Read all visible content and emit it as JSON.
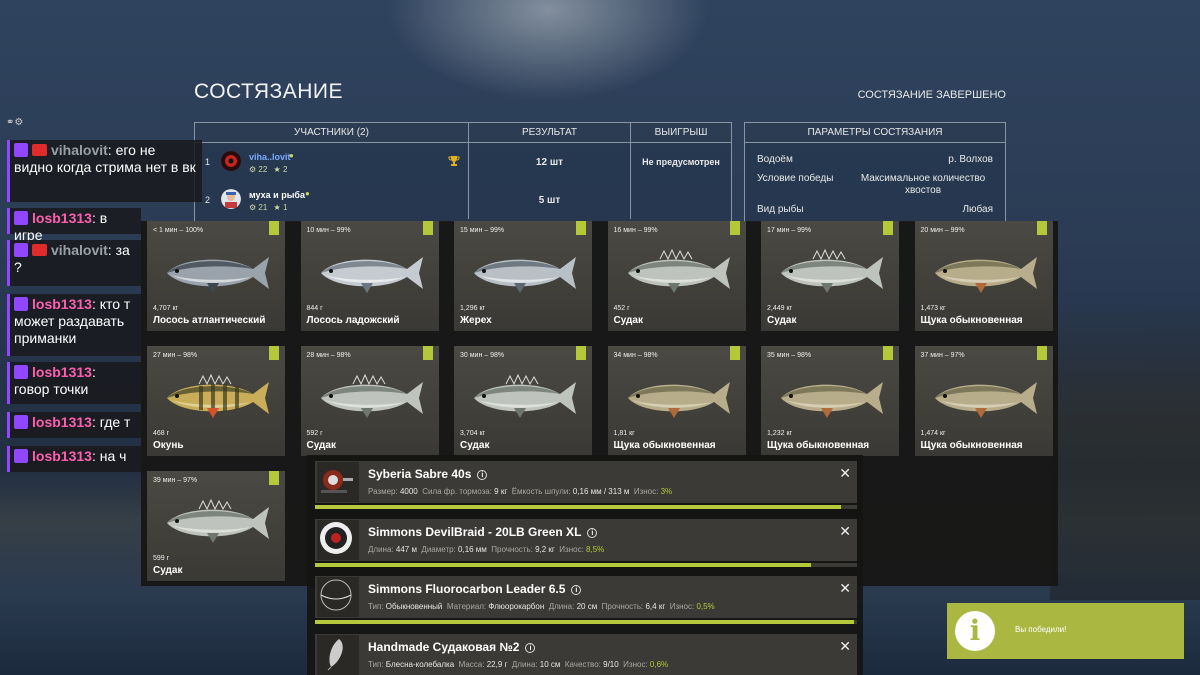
{
  "header": {
    "title": "СОСТЯЗАНИЕ",
    "status": "СОСТЯЗАНИЕ ЗАВЕРШЕНО"
  },
  "participants": {
    "headers": [
      "УЧАСТНИКИ (2)",
      "РЕЗУЛЬТАТ",
      "ВЫИГРЫШ"
    ],
    "rows": [
      {
        "num": "1",
        "name": "viha..lovit",
        "level": "22",
        "stars": "2",
        "result": "12 шт",
        "prize": "Не предусмотрен",
        "name_color": "#7aa9ff"
      },
      {
        "num": "2",
        "name": "муха и рыба",
        "level": "21",
        "stars": "1",
        "result": "5 шт",
        "prize": "",
        "name_color": "#ffffff"
      }
    ]
  },
  "params": {
    "header": "ПАРАМЕТРЫ СОСТЯЗАНИЯ",
    "rows": [
      {
        "label": "Водоём",
        "value": "р. Волхов"
      },
      {
        "label": "Условие победы",
        "value": "Максимальное количество хвостов"
      },
      {
        "label": "Вид рыбы",
        "value": "Любая"
      }
    ]
  },
  "chat": [
    {
      "user": "vihalovit",
      "text": ": его не видно когда стрима нет в вк",
      "cam": true
    },
    {
      "user": "losb1313",
      "text": ": в игре",
      "cam": false
    },
    {
      "user": "vihalovit",
      "text": ": за ?",
      "cam": true
    },
    {
      "user": "losb1313",
      "text": ": кто т может раздавать приманки",
      "cam": false
    },
    {
      "user": "losb1313",
      "text": ": говор точки",
      "cam": false
    },
    {
      "user": "losb1313",
      "text": ": где т",
      "cam": false
    },
    {
      "user": "losb1313",
      "text": ": на ч",
      "cam": false
    }
  ],
  "fish": [
    {
      "time": "< 1 мин – 100%",
      "weight": "4,707 кг",
      "name": "Лосось атлантический",
      "kind": "salmon"
    },
    {
      "time": "10 мин – 99%",
      "weight": "844 г",
      "name": "Лосось ладожский",
      "kind": "trout"
    },
    {
      "time": "15 мин – 99%",
      "weight": "1,296 кг",
      "name": "Жерех",
      "kind": "asp"
    },
    {
      "time": "16 мин – 99%",
      "weight": "452 г",
      "name": "Судак",
      "kind": "zander"
    },
    {
      "time": "17 мин – 99%",
      "weight": "2,449 кг",
      "name": "Судак",
      "kind": "zander"
    },
    {
      "time": "20 мин – 99%",
      "weight": "1,473 кг",
      "name": "Щука обыкновенная",
      "kind": "pike"
    },
    {
      "time": "27 мин – 98%",
      "weight": "468 г",
      "name": "Окунь",
      "kind": "perch"
    },
    {
      "time": "28 мин – 98%",
      "weight": "592 г",
      "name": "Судак",
      "kind": "zander"
    },
    {
      "time": "30 мин – 98%",
      "weight": "3,704 кг",
      "name": "Судак",
      "kind": "zander"
    },
    {
      "time": "34 мин – 98%",
      "weight": "1,81 кг",
      "name": "Щука обыкновенная",
      "kind": "pike"
    },
    {
      "time": "35 мин – 98%",
      "weight": "1,232 кг",
      "name": "Щука обыкновенная",
      "kind": "pike"
    },
    {
      "time": "37 мин – 97%",
      "weight": "1,474 кг",
      "name": "Щука обыкновенная",
      "kind": "pike"
    },
    {
      "time": "39 мин – 97%",
      "weight": "599 г",
      "name": "Судак",
      "kind": "zander"
    }
  ],
  "equipment": [
    {
      "name": "Syberia Sabre 40s",
      "wear": 0.97,
      "specs": [
        [
          "Размер:",
          "4000"
        ],
        [
          "Сила фр. тормоза:",
          "9 кг"
        ],
        [
          "Ёмкость шпули:",
          "0,16 мм / 313 м"
        ],
        [
          "Износ:",
          "3%"
        ]
      ],
      "icon": "reel-icon"
    },
    {
      "name": "Simmons DevilBraid - 20LB Green XL",
      "wear": 0.915,
      "specs": [
        [
          "Длина:",
          "447 м"
        ],
        [
          "Диаметр:",
          "0,16 мм"
        ],
        [
          "Прочность:",
          "9,2 кг"
        ],
        [
          "Износ:",
          "8,5%"
        ]
      ],
      "icon": "braid-icon"
    },
    {
      "name": "Simmons Fluorocarbon Leader 6.5",
      "wear": 0.995,
      "specs": [
        [
          "Тип:",
          "Обыкновенный"
        ],
        [
          "Материал:",
          "Флюорокарбон"
        ],
        [
          "Длина:",
          "20 см"
        ],
        [
          "Прочность:",
          "6,4 кг"
        ],
        [
          "Износ:",
          "0,5%"
        ]
      ],
      "icon": "leader-icon"
    },
    {
      "name": "Handmade Судаковая №2",
      "wear": 0.994,
      "specs": [
        [
          "Тип:",
          "Блесна-колебалка"
        ],
        [
          "Масса:",
          "22,9 г"
        ],
        [
          "Длина:",
          "10 см"
        ],
        [
          "Качество:",
          "9/10"
        ],
        [
          "Износ:",
          "0,6%"
        ]
      ],
      "icon": "spoon-lure-icon"
    }
  ],
  "toast": {
    "icon": "i",
    "text": "Вы победили!"
  },
  "colors": {
    "accent": "#b5c83a",
    "twitch": "#9146ff",
    "chat_user": "#ff5fb0"
  }
}
